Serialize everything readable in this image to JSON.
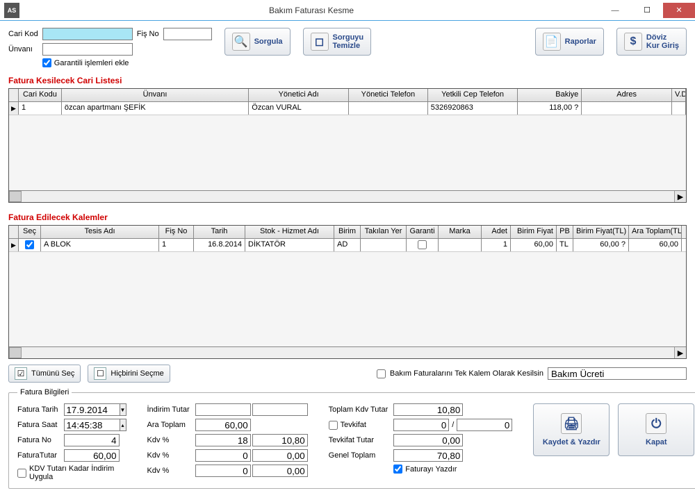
{
  "window": {
    "title": "Bakım Faturası Kesme",
    "app": "AS"
  },
  "search": {
    "cari_kod_label": "Cari Kod",
    "unvani_label": "Ünvanı",
    "fis_no_label": "Fiş No",
    "cari_kod": "",
    "unvani": "",
    "fis_no": "",
    "garanti_cb": "Garantili işlemleri ekle"
  },
  "buttons": {
    "sorgula": "Sorgula",
    "sorguyu": "Sorguyu",
    "temizle": "Temizle",
    "raporlar": "Raporlar",
    "doviz": "Döviz",
    "kurgiris": "Kur Giriş",
    "tumunu": "Tümünü Seç",
    "hicbirini": "Hiçbirini Seçme",
    "kaydet": "Kaydet & Yazdır",
    "kapat": "Kapat"
  },
  "section1": {
    "title": "Fatura Kesilecek Cari Listesi",
    "headers": {
      "cari": "Cari Kodu",
      "unv": "Ünvanı",
      "yad": "Yönetici Adı",
      "ytel": "Yönetici Telefon",
      "ycep": "Yetkili Cep Telefon",
      "bak": "Bakiye",
      "adr": "Adres",
      "vd": "V.D"
    },
    "row": {
      "cari": "1",
      "unv": "özcan apartmanı ŞEFİK",
      "yad": "Özcan VURAL",
      "ytel": "",
      "ycep": "5326920863",
      "bak": "118,00 ?",
      "adr": ""
    }
  },
  "section2": {
    "title": "Fatura Edilecek Kalemler",
    "headers": {
      "sec": "Seç",
      "tes": "Tesis Adı",
      "fis": "Fiş No",
      "tar": "Tarih",
      "stok": "Stok - Hizmet Adı",
      "bir": "Birim",
      "tak": "Takılan Yer",
      "gar": "Garanti",
      "mar": "Marka",
      "adet": "Adet",
      "bf": "Birim Fiyat",
      "pb": "PB",
      "bftl": "Birim Fiyat(TL)",
      "ara": "Ara Toplam(TL)"
    },
    "row": {
      "sec": true,
      "tes": "A BLOK",
      "fis": "1",
      "tar": "16.8.2014",
      "stok": "DİKTATÖR",
      "bir": "AD",
      "tak": "",
      "gar": false,
      "mar": "",
      "adet": "1",
      "bf": "60,00",
      "pb": "TL",
      "bftl": "60,00 ?",
      "ara": "60,00"
    }
  },
  "mid": {
    "tek_kalem_label": "Bakım Faturalarını Tek Kalem Olarak Kesilsin",
    "tek_kalem_val": "Bakım Ücreti"
  },
  "fb": {
    "legend": "Fatura Bilgileri",
    "tarih_l": "Fatura Tarih",
    "tarih": "17.9.2014",
    "saat_l": "Fatura Saat",
    "saat": "14:45:38",
    "no_l": "Fatura No",
    "no": "4",
    "tutar_l": "FaturaTutar",
    "tutar": "60,00",
    "kdv_indirim_cb": "KDV Tutarı Kadar İndirim Uygula",
    "indirim_l": "İndirim Tutar",
    "indirim1": "",
    "indirim2": "",
    "ara_l": "Ara Toplam",
    "ara": "60,00",
    "kdv1_l": "Kdv %",
    "kdv1a": "18",
    "kdv1b": "10,80",
    "kdv2_l": "Kdv %",
    "kdv2a": "0",
    "kdv2b": "0,00",
    "kdv3_l": "Kdv %",
    "kdv3a": "0",
    "kdv3b": "0,00",
    "tkdv_l": "Toplam Kdv Tutar",
    "tkdv": "10,80",
    "tevk_l": "Tevkifat",
    "tevk1": "0",
    "tevk2": "0",
    "tevkt_l": "Tevkifat Tutar",
    "tevkt": "0,00",
    "genel_l": "Genel Toplam",
    "genel": "70,80",
    "yazdir_cb": "Faturayı Yazdır"
  }
}
